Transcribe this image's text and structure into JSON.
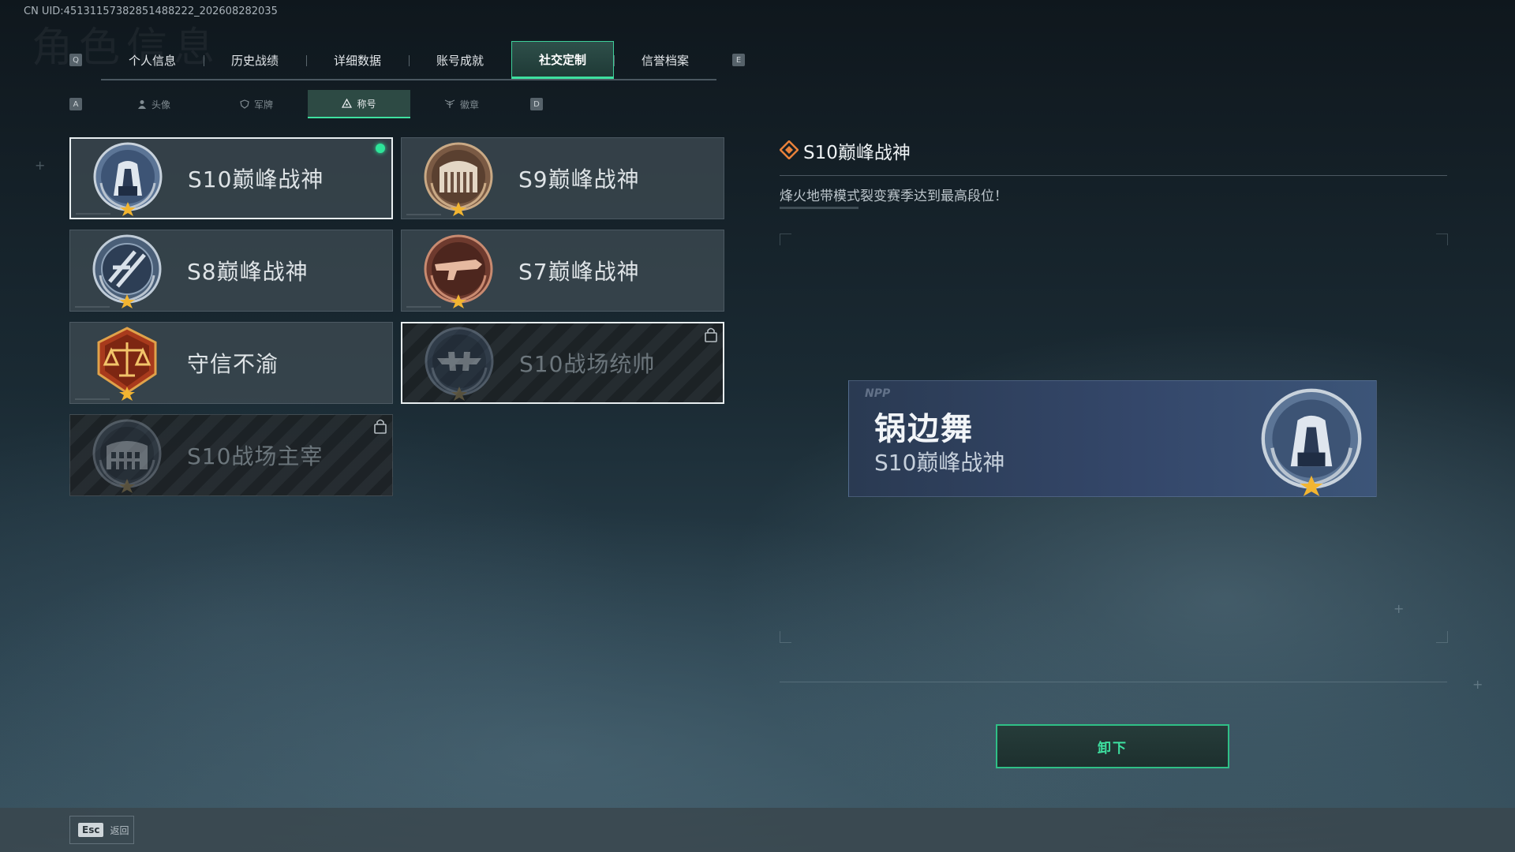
{
  "uid": "CN UID:451311573828514882​22_202608282035",
  "tabs": {
    "prev_key": "Q",
    "next_key": "E",
    "items": [
      "个人信息",
      "历史战绩",
      "详细数据",
      "账号成就",
      "社交定制",
      "信誉档案"
    ],
    "active_index": 4
  },
  "subtabs": {
    "prev_key": "A",
    "next_key": "D",
    "items": [
      {
        "label": "头像",
        "icon": "person-icon"
      },
      {
        "label": "军牌",
        "icon": "shield-icon"
      },
      {
        "label": "称号",
        "icon": "triangle-icon"
      },
      {
        "label": "徽章",
        "icon": "wings-icon"
      }
    ],
    "active_index": 2
  },
  "titles": [
    {
      "name": "S10巅峰战神",
      "emblem": "tower-emblem-icon",
      "state": "equipped-selected"
    },
    {
      "name": "S9巅峰战神",
      "emblem": "gate-emblem-icon",
      "state": "owned"
    },
    {
      "name": "S8巅峰战神",
      "emblem": "slash-emblem-icon",
      "state": "owned"
    },
    {
      "name": "S7巅峰战神",
      "emblem": "rifle-emblem-icon",
      "state": "owned"
    },
    {
      "name": "守信不渝",
      "emblem": "scales-emblem-icon",
      "state": "owned"
    },
    {
      "name": "S10战场统帅",
      "emblem": "aircraft-emblem-icon",
      "state": "locked-highlighted"
    },
    {
      "name": "S10战场主宰",
      "emblem": "colosseum-emblem-icon",
      "state": "locked"
    }
  ],
  "detail": {
    "title": "S10巅峰战神",
    "description": "烽火地带模式裂变赛季达到最高段位！"
  },
  "banner": {
    "player_name": "锅边舞",
    "title": "S10巅峰战神"
  },
  "actions": {
    "unequip_label": "卸下"
  },
  "footer": {
    "esc_key": "Esc",
    "back_label": "返回"
  },
  "colors": {
    "accent": "#3ee0a0",
    "star": "#f2b531"
  }
}
